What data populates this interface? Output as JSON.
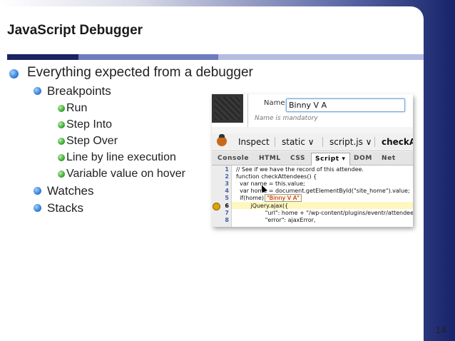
{
  "slide": {
    "title": "JavaScript Debugger",
    "page_number": "14",
    "bullets": [
      {
        "text": "Everything expected from a debugger"
      },
      {
        "text": "Breakpoints"
      },
      {
        "text": "Run"
      },
      {
        "text": "Step Into"
      },
      {
        "text": "Step Over"
      },
      {
        "text": "Line by line execution"
      },
      {
        "text": "Variable value on hover"
      },
      {
        "text": "Watches"
      },
      {
        "text": "Stacks"
      }
    ]
  },
  "screenshot": {
    "form": {
      "name_label": "Name",
      "name_value": "Binny V A",
      "name_help": "Name is mandatory"
    },
    "toolbar": {
      "inspect": "Inspect",
      "static": "static ∨",
      "script": "script.js ∨",
      "func": "checkA"
    },
    "tabs": [
      "Console",
      "HTML",
      "CSS",
      "Script ▾",
      "DOM",
      "Net"
    ],
    "code_lines": [
      {
        "num": "1",
        "text": "// See if we have the record of this attendee."
      },
      {
        "num": "2",
        "text": "function checkAttendees() {"
      },
      {
        "num": "3",
        "text": "  var name = this.value;"
      },
      {
        "num": "4",
        "text": "  var home = document.getElementById(\"site_home\").value;"
      },
      {
        "num": "5",
        "text": "  if(home) {"
      },
      {
        "num": "6",
        "text": "        jQuery.ajax({"
      },
      {
        "num": "7",
        "text": "                \"url\": home + \"/wp-content/plugins/eventr/attendee"
      },
      {
        "num": "8",
        "text": "                \"error\": ajaxError,"
      }
    ],
    "tooltip": "\"Binny V A\""
  },
  "colors": {
    "title_rule_dark": "#1a2463",
    "title_rule_mid": "#6e7bbd",
    "title_rule_light": "#b5bce0",
    "bullet_blue": "#2a74d0",
    "bullet_green": "#2f9a2a"
  },
  "icons": {
    "level1_bullet": "blue-sphere-bullet-icon",
    "level3_bullet": "green-sphere-bullet-icon",
    "firebug": "firebug-icon",
    "breakpoint": "breakpoint-arrow-icon"
  }
}
